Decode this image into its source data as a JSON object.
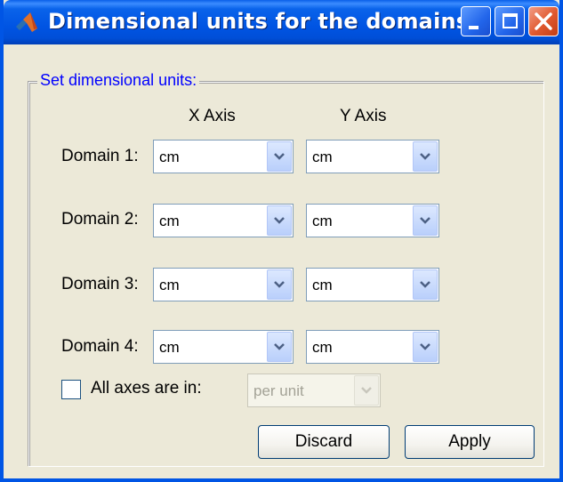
{
  "window": {
    "title": "Dimensional units for the domains",
    "accent_color": "#0054e3",
    "close_color": "#e0582e"
  },
  "group": {
    "legend": "Set dimensional units:"
  },
  "columns": {
    "x_axis": "X Axis",
    "y_axis": "Y Axis"
  },
  "domains": [
    {
      "label": "Domain 1:",
      "x_unit": "cm",
      "y_unit": "cm"
    },
    {
      "label": "Domain 2:",
      "x_unit": "cm",
      "y_unit": "cm"
    },
    {
      "label": "Domain 3:",
      "x_unit": "cm",
      "y_unit": "cm"
    },
    {
      "label": "Domain 4:",
      "x_unit": "cm",
      "y_unit": "cm"
    }
  ],
  "all_axes": {
    "label": "All axes are in:",
    "checked": false,
    "unit": "per unit",
    "enabled": false
  },
  "buttons": {
    "discard": "Discard",
    "apply": "Apply"
  },
  "icons": {
    "window_icon": "matlab-icon",
    "dropdown": "chevron-down-icon"
  }
}
